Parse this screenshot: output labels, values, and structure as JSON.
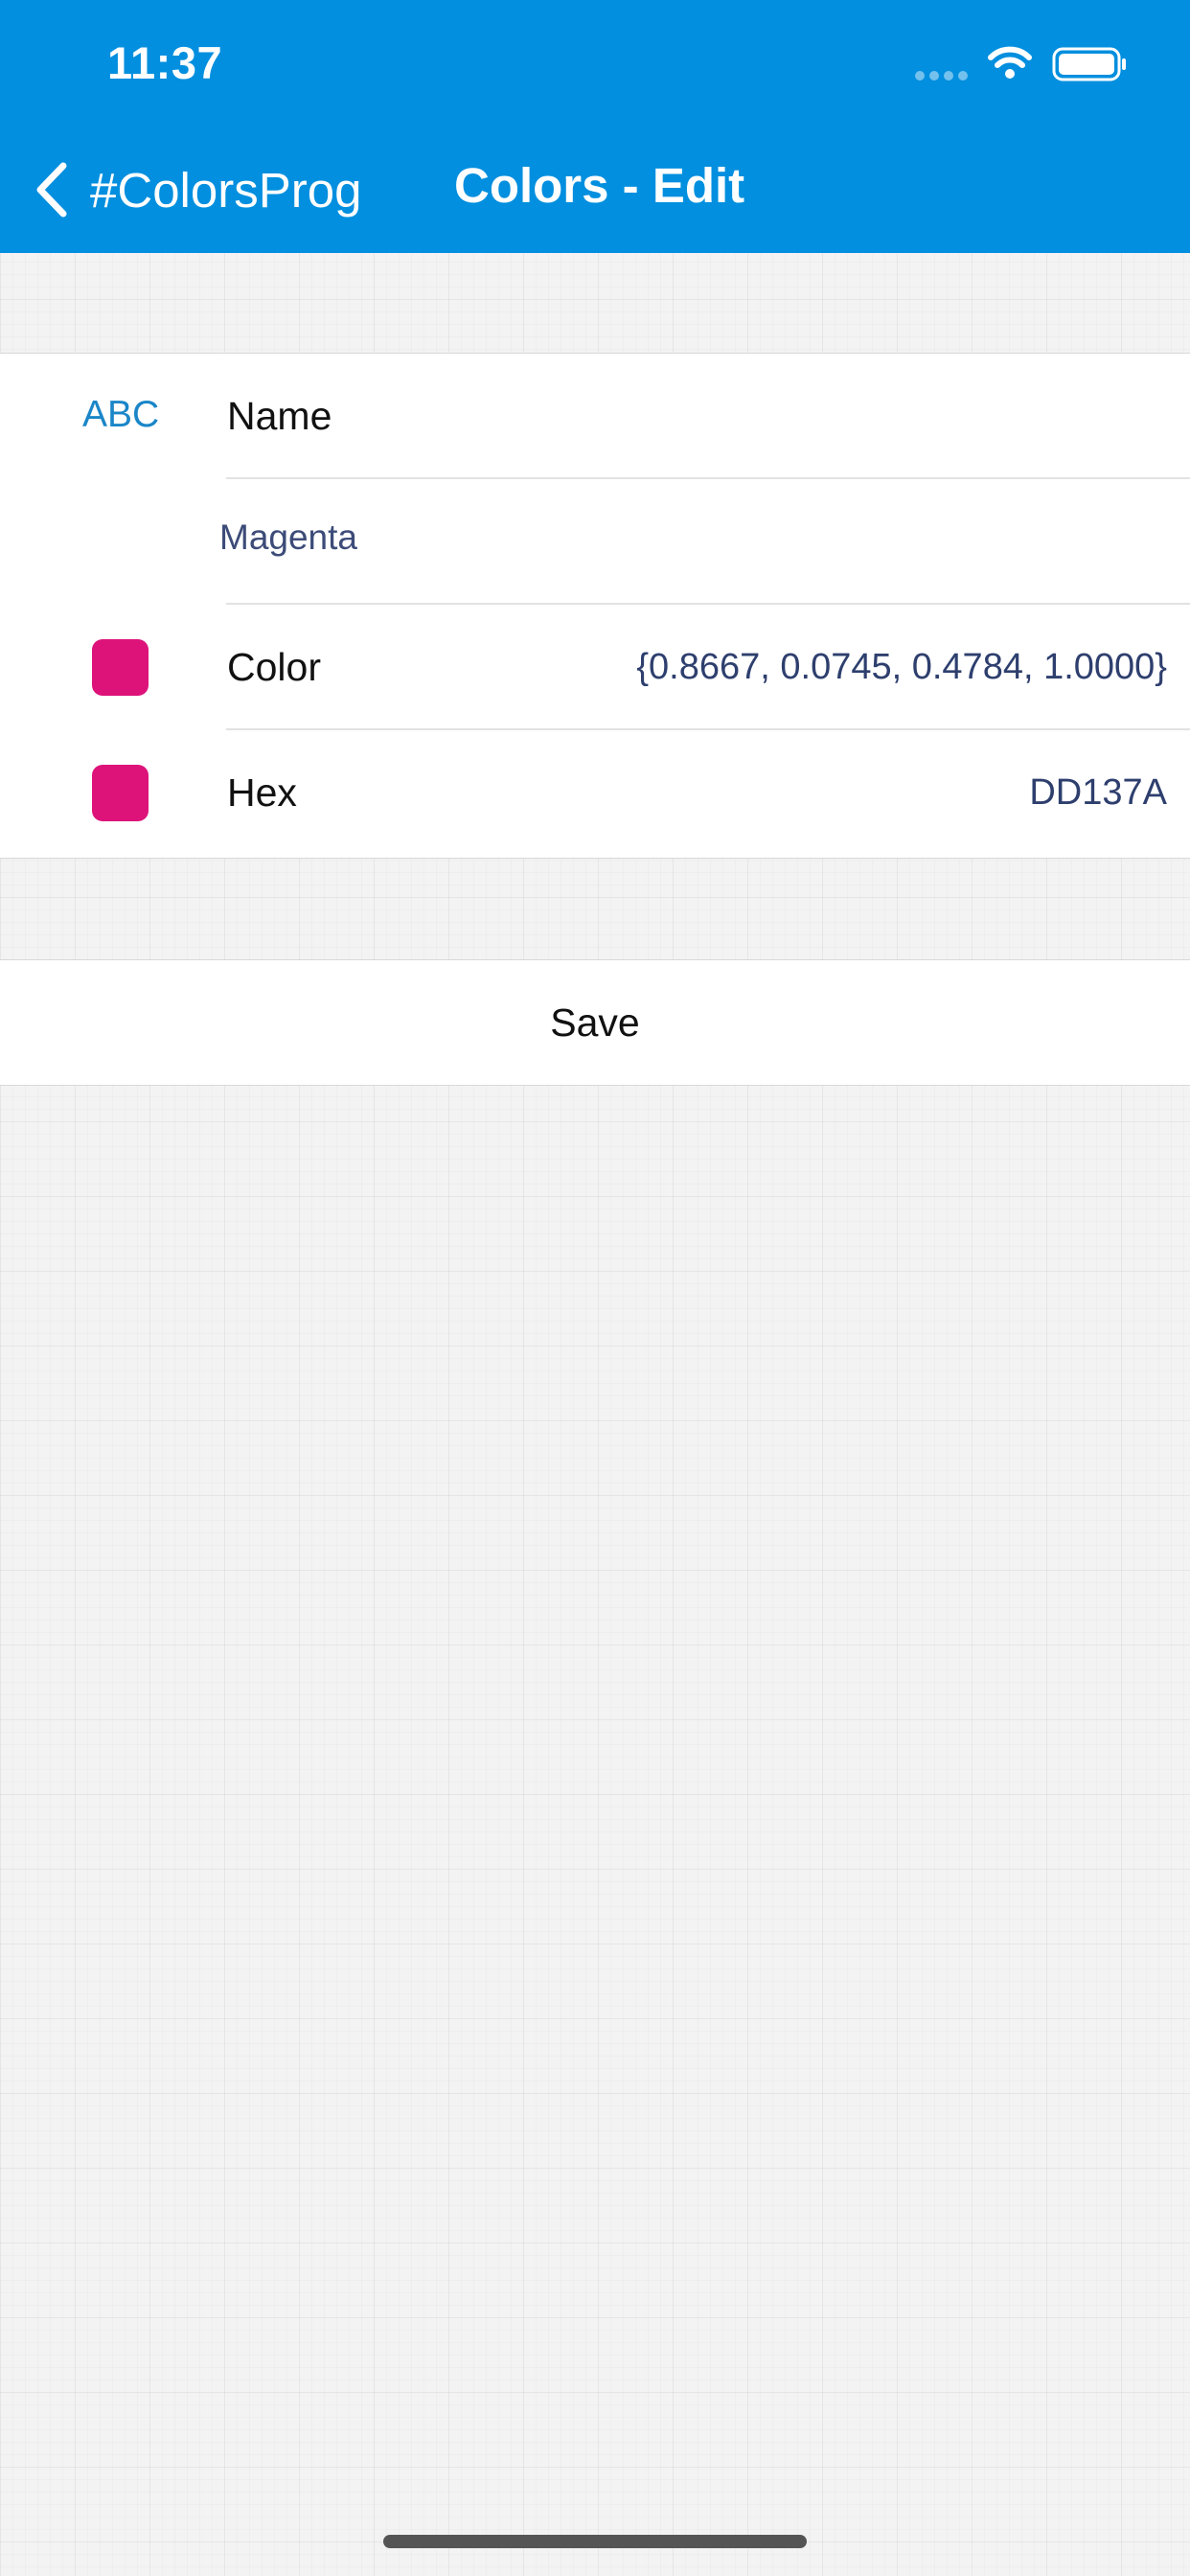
{
  "status_bar": {
    "time": "11:37"
  },
  "nav": {
    "back_label": "#ColorsProg",
    "title": "Colors - Edit"
  },
  "form": {
    "name_row": {
      "icon_text": "ABC",
      "label": "Name"
    },
    "name_input": {
      "value": "Magenta"
    },
    "color_row": {
      "label": "Color",
      "value": "{0.8667, 0.0745, 0.4784, 1.0000}"
    },
    "hex_row": {
      "label": "Hex",
      "value": "DD137A"
    }
  },
  "actions": {
    "save_label": "Save"
  },
  "colors": {
    "header": "#028fdf",
    "swatch": "#dd137a",
    "accent_text": "#1b86c8"
  },
  "icons": [
    "back-chevron-icon",
    "abc-icon",
    "wifi-icon",
    "battery-icon",
    "cellular-signal-icon"
  ]
}
